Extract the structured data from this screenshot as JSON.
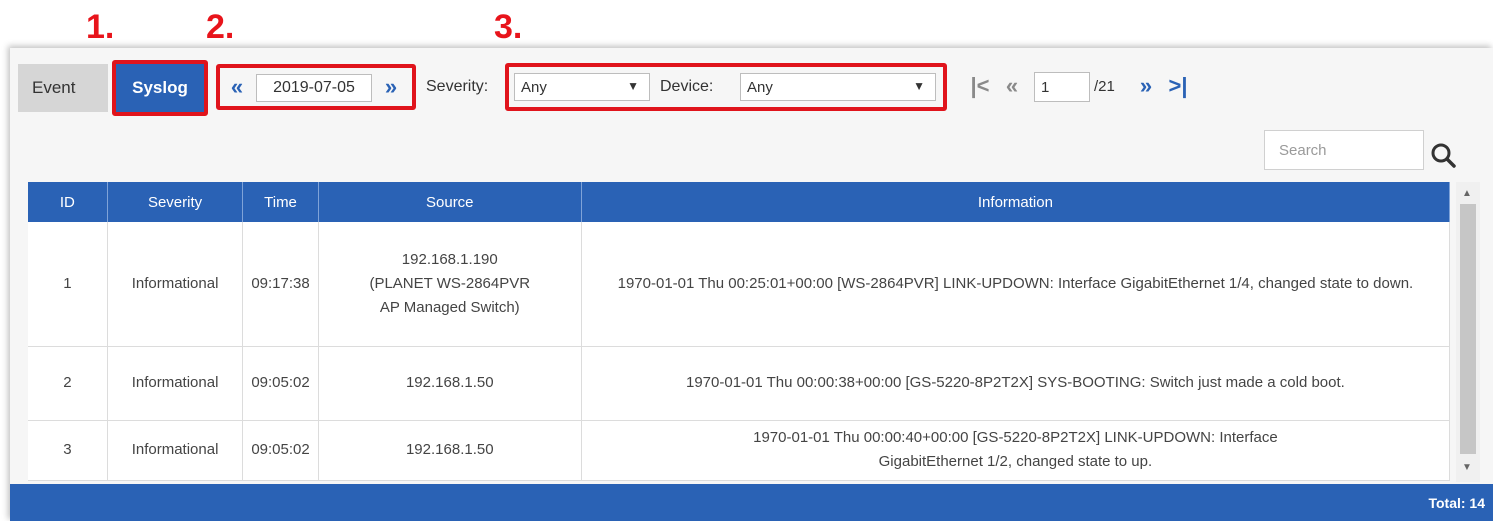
{
  "callouts": [
    "1.",
    "2.",
    "3."
  ],
  "tabs": {
    "event": "Event",
    "syslog": "Syslog"
  },
  "date": {
    "prev": "«",
    "value": "2019-07-05",
    "next": "»"
  },
  "filters": {
    "severity_label": "Severity:",
    "severity_value": "Any",
    "device_label": "Device:",
    "device_value": "Any"
  },
  "pager": {
    "first": "|<",
    "prev": "«",
    "current": "1",
    "total": "/21",
    "next": "»",
    "last": ">|"
  },
  "search": {
    "placeholder": "Search"
  },
  "table": {
    "headers": [
      "ID",
      "Severity",
      "Time",
      "Source",
      "Information"
    ],
    "rows": [
      {
        "id": "1",
        "severity": "Informational",
        "time": "09:17:38",
        "source": "192.168.1.190 (PLANET WS-2864PVR AP Managed Switch)",
        "info": "1970-01-01 Thu 00:25:01+00:00 [WS-2864PVR] LINK-UPDOWN: Interface GigabitEthernet 1/4, changed state to down."
      },
      {
        "id": "2",
        "severity": "Informational",
        "time": "09:05:02",
        "source": "192.168.1.50",
        "info": "1970-01-01 Thu 00:00:38+00:00 [GS-5220-8P2T2X] SYS-BOOTING: Switch just made a cold boot."
      },
      {
        "id": "3",
        "severity": "Informational",
        "time": "09:05:02",
        "source": "192.168.1.50",
        "info": "1970-01-01 Thu 00:00:40+00:00 [GS-5220-8P2T2X] LINK-UPDOWN: Interface GigabitEthernet 1/2, changed state to up."
      }
    ]
  },
  "footer": {
    "total": "Total: 14"
  },
  "colors": {
    "accent": "#2a62b5",
    "highlight": "#e0141c"
  }
}
